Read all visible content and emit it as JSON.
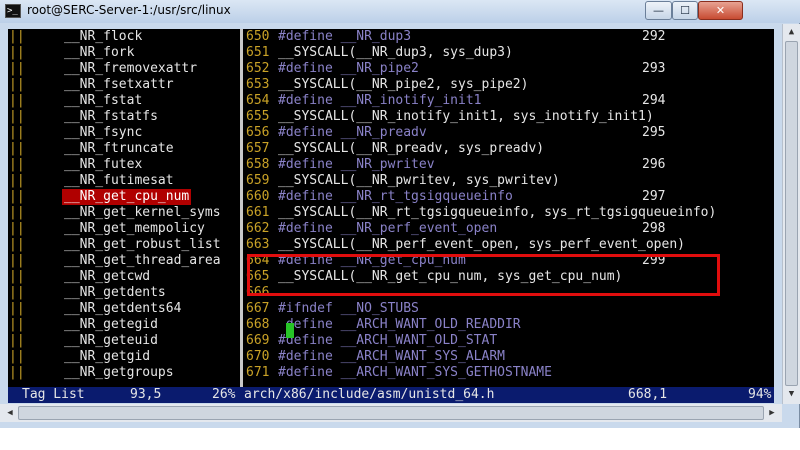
{
  "window": {
    "title": "root@SERC-Server-1:/usr/src/linux",
    "app_icon": "terminal-icon",
    "minimize_label": "—",
    "maximize_label": "☐",
    "close_label": "✕"
  },
  "taglist": {
    "bars": "||",
    "items": [
      {
        "name": "__NR_flock",
        "selected": false
      },
      {
        "name": "__NR_fork",
        "selected": false
      },
      {
        "name": "__NR_fremovexattr",
        "selected": false
      },
      {
        "name": "__NR_fsetxattr",
        "selected": false
      },
      {
        "name": "__NR_fstat",
        "selected": false
      },
      {
        "name": "__NR_fstatfs",
        "selected": false
      },
      {
        "name": "__NR_fsync",
        "selected": false
      },
      {
        "name": "__NR_ftruncate",
        "selected": false
      },
      {
        "name": "__NR_futex",
        "selected": false
      },
      {
        "name": "__NR_futimesat",
        "selected": false
      },
      {
        "name": "__NR_get_cpu_num",
        "selected": true
      },
      {
        "name": "__NR_get_kernel_syms",
        "selected": false
      },
      {
        "name": "__NR_get_mempolicy",
        "selected": false
      },
      {
        "name": "__NR_get_robust_list",
        "selected": false
      },
      {
        "name": "__NR_get_thread_area",
        "selected": false
      },
      {
        "name": "__NR_getcwd",
        "selected": false
      },
      {
        "name": "__NR_getdents",
        "selected": false
      },
      {
        "name": "__NR_getdents64",
        "selected": false
      },
      {
        "name": "__NR_getegid",
        "selected": false
      },
      {
        "name": "__NR_geteuid",
        "selected": false
      },
      {
        "name": "__NR_getgid",
        "selected": false
      },
      {
        "name": "__NR_getgroups",
        "selected": false
      }
    ]
  },
  "code": {
    "lines": [
      {
        "num": "650",
        "text": "#define __NR_dup3",
        "comment": true,
        "nr": "292"
      },
      {
        "num": "651",
        "text": "__SYSCALL(__NR_dup3, sys_dup3)",
        "comment": false,
        "nr": ""
      },
      {
        "num": "652",
        "text": "#define __NR_pipe2",
        "comment": true,
        "nr": "293"
      },
      {
        "num": "653",
        "text": "__SYSCALL(__NR_pipe2, sys_pipe2)",
        "comment": false,
        "nr": ""
      },
      {
        "num": "654",
        "text": "#define __NR_inotify_init1",
        "comment": true,
        "nr": "294"
      },
      {
        "num": "655",
        "text": "__SYSCALL(__NR_inotify_init1, sys_inotify_init1)",
        "comment": false,
        "nr": ""
      },
      {
        "num": "656",
        "text": "#define __NR_preadv",
        "comment": true,
        "nr": "295"
      },
      {
        "num": "657",
        "text": "__SYSCALL(__NR_preadv, sys_preadv)",
        "comment": false,
        "nr": ""
      },
      {
        "num": "658",
        "text": "#define __NR_pwritev",
        "comment": true,
        "nr": "296"
      },
      {
        "num": "659",
        "text": "__SYSCALL(__NR_pwritev, sys_pwritev)",
        "comment": false,
        "nr": ""
      },
      {
        "num": "660",
        "text": "#define __NR_rt_tgsigqueueinfo",
        "comment": true,
        "nr": "297"
      },
      {
        "num": "661",
        "text": "__SYSCALL(__NR_rt_tgsigqueueinfo, sys_rt_tgsigqueueinfo)",
        "comment": false,
        "nr": ""
      },
      {
        "num": "662",
        "text": "#define __NR_perf_event_open",
        "comment": true,
        "nr": "298"
      },
      {
        "num": "663",
        "text": "__SYSCALL(__NR_perf_event_open, sys_perf_event_open)",
        "comment": false,
        "nr": ""
      },
      {
        "num": "664",
        "text": "#define __NR_get_cpu_num",
        "comment": true,
        "nr": "299"
      },
      {
        "num": "665",
        "text": "__SYSCALL(__NR_get_cpu_num, sys_get_cpu_num)",
        "comment": false,
        "nr": ""
      },
      {
        "num": "666",
        "text": "",
        "comment": false,
        "nr": ""
      },
      {
        "num": "667",
        "text": "#ifndef __NO_STUBS",
        "comment": true,
        "nr": ""
      },
      {
        "num": "668",
        "text": " define __ARCH_WANT_OLD_READDIR",
        "comment": true,
        "nr": ""
      },
      {
        "num": "669",
        "text": "#define __ARCH_WANT_OLD_STAT",
        "comment": true,
        "nr": ""
      },
      {
        "num": "670",
        "text": "#define __ARCH_WANT_SYS_ALARM",
        "comment": true,
        "nr": ""
      },
      {
        "num": "671",
        "text": "#define __ARCH_WANT_SYS_GETHOSTNAME",
        "comment": true,
        "nr": ""
      }
    ]
  },
  "status": {
    "tag_label": "Tag List",
    "tag_pos": "93,5",
    "percent": "26%",
    "file": "arch/x86/include/asm/unistd_64.h",
    "cursor_pos": "668,1",
    "file_percent": "94%"
  },
  "colors": {
    "terminal_bg": "#000000",
    "line_number": "#c9a227",
    "comment": "#8a82c8",
    "selection": "#b00000",
    "status_bg": "#0a1b6e",
    "cursor": "#27c427",
    "highlight_box": "#e10d0d"
  }
}
